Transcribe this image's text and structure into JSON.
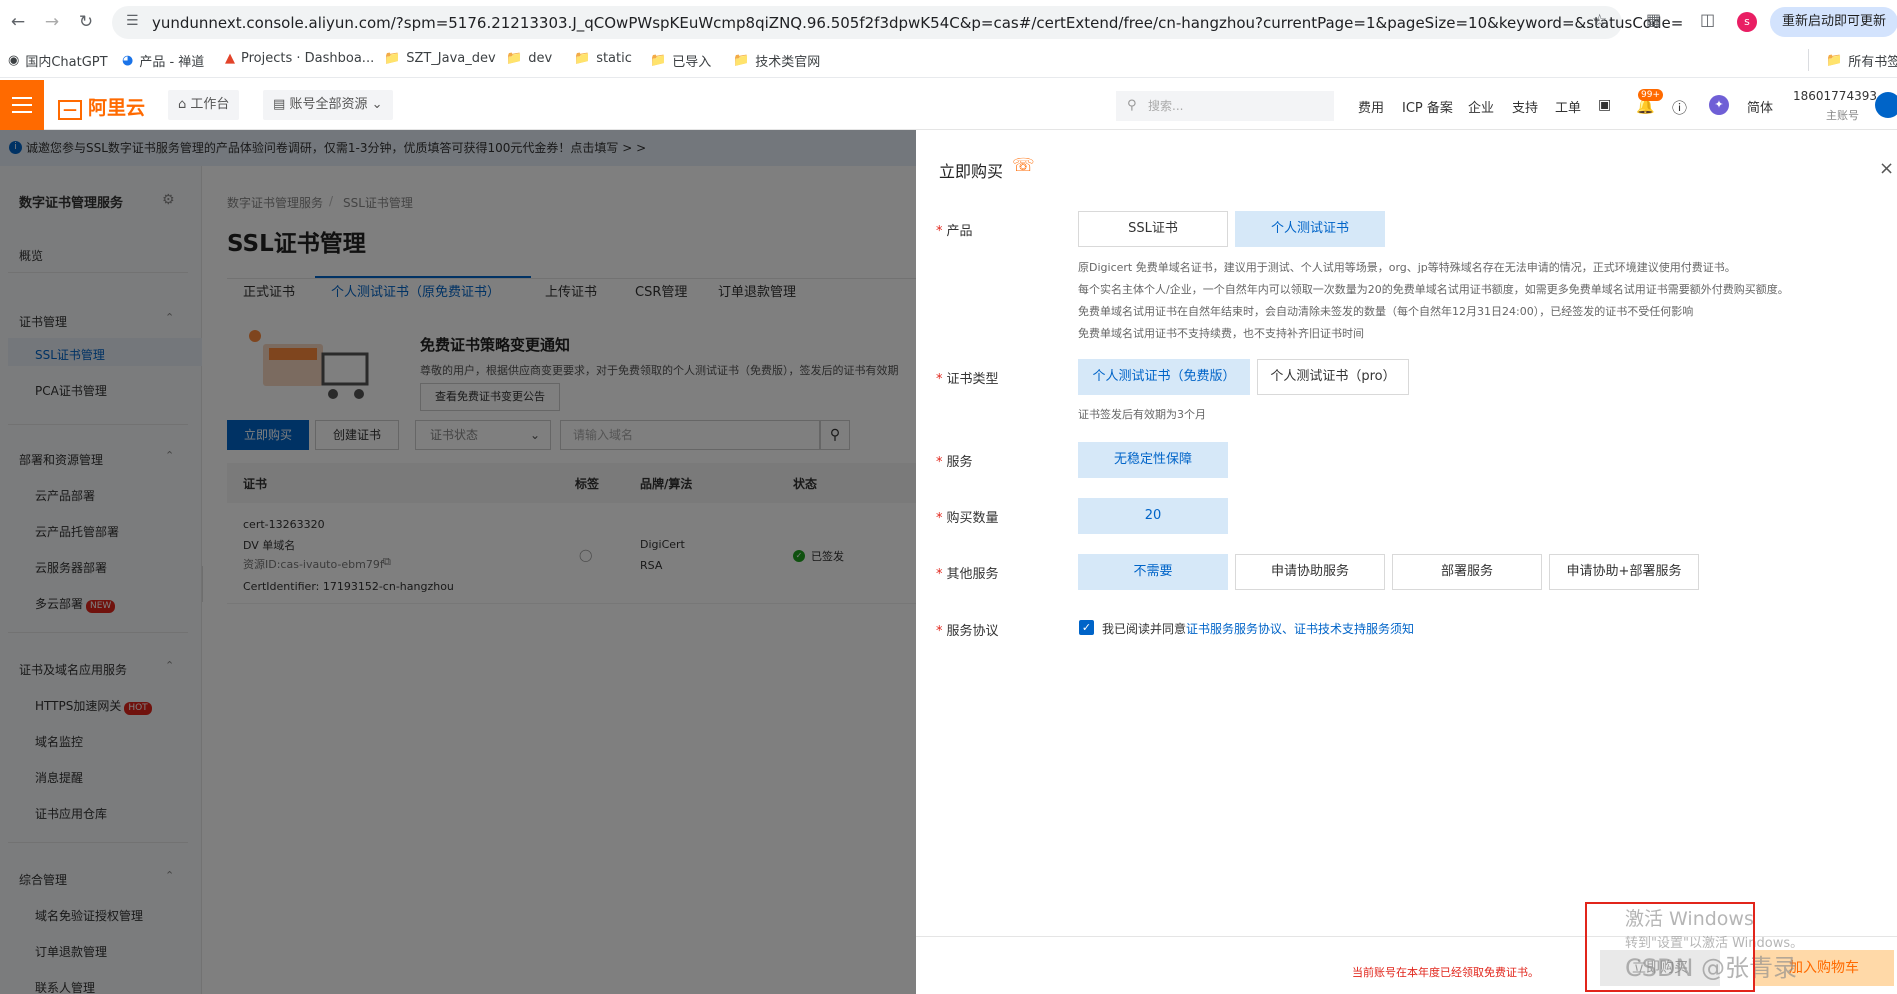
{
  "browser": {
    "url": "yundunnext.console.aliyun.com/?spm=5176.21213303.J_qCOwPWspKEuWcmp8qiZNQ.96.505f2f3dpwK54C&p=cas#/certExtend/free/cn-hangzhou?currentPage=1&pageSize=10&keyword=&statusCode=",
    "profile_initial": "s",
    "update_button": "重新启动即可更新",
    "bookmarks": [
      "国内ChatGPT",
      "产品 - 禅道",
      "Projects · Dashboa...",
      "SZT_Java_dev",
      "dev",
      "static",
      "已导入",
      "技术类官网"
    ],
    "all_bookmarks": "所有书签"
  },
  "header": {
    "logo": "阿里云",
    "workbench": "工作台",
    "resources": "账号全部资源",
    "search_placeholder": "搜索...",
    "links": [
      "费用",
      "ICP 备案",
      "企业",
      "支持",
      "工单"
    ],
    "badge": "99+",
    "lang": "简体",
    "account": "18601774393",
    "account_sub": "主账号"
  },
  "banner": "诚邀您参与SSL数字证书服务管理的产品体验问卷调研，仅需1-3分钟，优质填答可获得100元代金券！点击填写 > >",
  "sidebar": {
    "title": "数字证书管理服务",
    "overview": "概览",
    "groups": [
      {
        "label": "证书管理",
        "items": [
          "SSL证书管理",
          "PCA证书管理"
        ]
      },
      {
        "label": "部署和资源管理",
        "items": [
          "云产品部署",
          "云产品托管部署",
          "云服务器部署",
          "多云部署"
        ]
      },
      {
        "label": "证书及域名应用服务",
        "items": [
          "HTTPS加速网关",
          "域名监控",
          "消息提醒",
          "证书应用仓库"
        ]
      },
      {
        "label": "综合管理",
        "items": [
          "域名免验证授权管理",
          "订单退款管理",
          "联系人管理"
        ]
      }
    ],
    "tag_new": "NEW",
    "tag_hot": "HOT"
  },
  "main": {
    "breadcrumb": [
      "数字证书管理服务",
      "SSL证书管理"
    ],
    "title": "SSL证书管理",
    "tabs": [
      "正式证书",
      "个人测试证书（原免费证书）",
      "上传证书",
      "CSR管理",
      "订单退款管理"
    ],
    "notice_title": "免费证书策略变更通知",
    "notice_text": "尊敬的用户，根据供应商变更要求，对于免费领取的个人测试证书（免费版），签发后的证书有效期",
    "notice_button": "查看免费证书变更公告",
    "buy_button": "立即购买",
    "create_button": "创建证书",
    "status_select": "证书状态",
    "domain_placeholder": "请输入域名",
    "columns": [
      "证书",
      "标签",
      "品牌/算法",
      "状态"
    ],
    "row": {
      "cert": "cert-13263320",
      "type": "DV 单域名",
      "resource": "资源ID:cas-ivauto-ebm79f",
      "identifier": "CertIdentifier: 17193152-cn-hangzhou",
      "brand": "DigiCert",
      "algo": "RSA",
      "status": "已签发"
    }
  },
  "drawer": {
    "title": "立即购买",
    "fields": {
      "product": {
        "label": "产品",
        "options": [
          "SSL证书",
          "个人测试证书"
        ],
        "selected": 1
      },
      "product_desc": [
        "原Digicert 免费单域名证书，建议用于测试、个人试用等场景，org、jp等特殊域名存在无法申请的情况，正式环境建议使用付费证书。",
        "每个实名主体个人/企业，一个自然年内可以领取一次数量为20的免费单域名试用证书额度，如需更多免费单域名试用证书需要额外付费购买额度。",
        "免费单域名试用证书在自然年结束时，会自动清除未签发的数量（每个自然年12月31日24:00），已经签发的证书不受任何影响",
        "免费单域名试用证书不支持续费，也不支持补齐旧证书时间"
      ],
      "cert_type": {
        "label": "证书类型",
        "options": [
          "个人测试证书（免费版）",
          "个人测试证书（pro）"
        ],
        "selected": 0
      },
      "cert_type_desc": "证书签发后有效期为3个月",
      "service": {
        "label": "服务",
        "options": [
          "无稳定性保障"
        ],
        "selected": 0
      },
      "quantity": {
        "label": "购买数量",
        "value": "20"
      },
      "other": {
        "label": "其他服务",
        "options": [
          "不需要",
          "申请协助服务",
          "部署服务",
          "申请协助+部署服务"
        ],
        "selected": 0
      },
      "agreement": {
        "label": "服务协议",
        "prefix": "我已阅读并同意",
        "link1": "证书服务服务协议",
        "sep": "、",
        "link2": "证书技术支持服务须知"
      }
    },
    "footer_warning": "当前账号在本年度已经领取免费证书。",
    "footer_buy": "立即购买",
    "footer_cart": "加入购物车"
  },
  "watermark": {
    "line1": "激活 Windows",
    "line2": "转到\"设置\"以激活 Windows。",
    "csdn": "CSDN @张青录"
  },
  "colors": {
    "brand": "#ff6a00",
    "primary": "#0064c8",
    "selected_bg": "#d6e8f8",
    "danger": "#e1251b",
    "success": "#1fa31f"
  }
}
